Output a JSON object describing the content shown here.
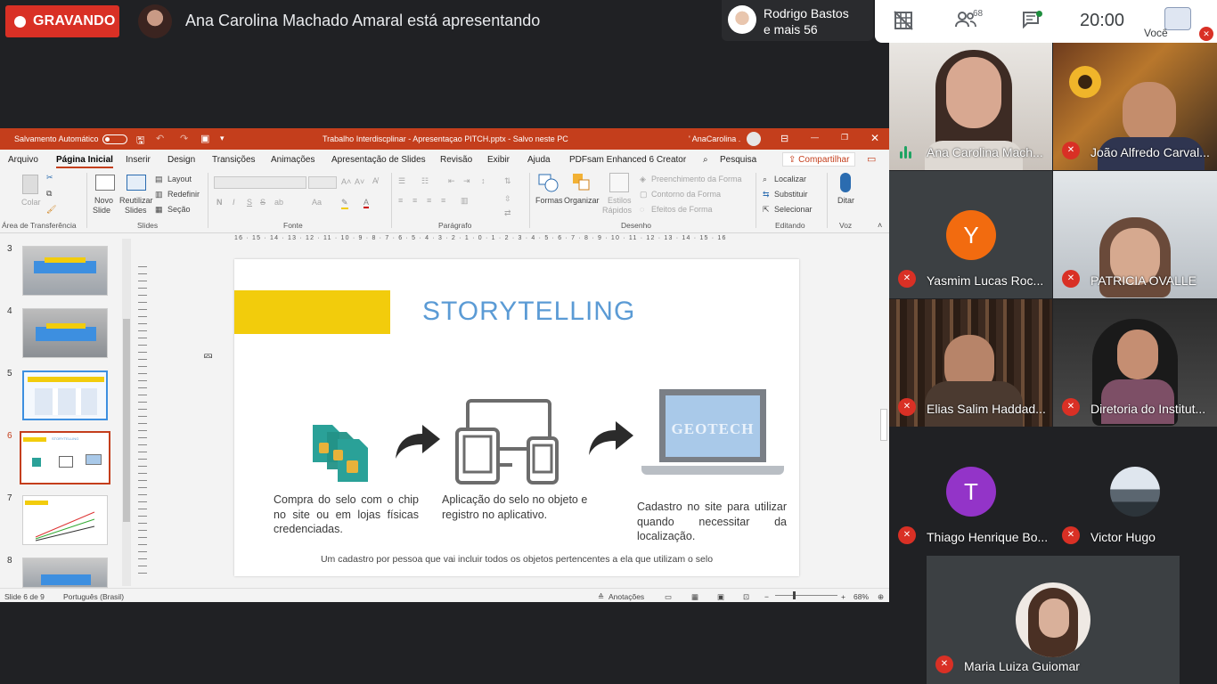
{
  "meet": {
    "recording_label": "GRAVANDO",
    "presenter_text": "Ana Carolina Machado Amaral está apresentando",
    "others_name": "Rodrigo Bastos",
    "others_more": "e mais 56",
    "participants_count": "68",
    "clock": "20:00",
    "you_label": "Você",
    "icons": [
      "grid-off-icon",
      "people-icon",
      "chat-icon",
      "mic-off-icon"
    ],
    "accent_red": "#d93025"
  },
  "ppt": {
    "autosave_label": "Salvamento Automático",
    "window_title": "Trabalho Interdiscplinar - Apresentaçao PITCH.pptx  -  Salvo neste PC",
    "user_name": "' AnaCarolina .",
    "menu": [
      "Arquivo",
      "Página Inicial",
      "Inserir",
      "Design",
      "Transições",
      "Animações",
      "Apresentação de Slides",
      "Revisão",
      "Exibir",
      "Ajuda",
      "PDFsam Enhanced 6 Creator",
      "Pesquisa"
    ],
    "share_label": "Compartilhar",
    "ribbon": {
      "paste": "Colar",
      "clipboard_group": "Área de Transferência",
      "new_slide": "Novo",
      "new_slide_2": "Slide",
      "reuse": "Reutilizar",
      "reuse_2": "Slides",
      "layout": "Layout",
      "reset": "Redefinir",
      "section": "Seção",
      "slides_group": "Slides",
      "font_group": "Fonte",
      "paragraph_group": "Parágrafo",
      "shapes": "Formas",
      "arrange": "Organizar",
      "quick_styles": "Estilos",
      "quick_styles_2": "Rápidos",
      "shape_fill": "Preenchimento da Forma",
      "shape_outline": "Contorno da Forma",
      "shape_effects": "Efeitos de Forma",
      "drawing_group": "Desenho",
      "find": "Localizar",
      "replace": "Substituir",
      "select": "Selecionar",
      "editing_group": "Editando",
      "dictate": "Ditar",
      "voice_group": "Voz"
    },
    "thumbnails": [
      {
        "num": "3"
      },
      {
        "num": "4"
      },
      {
        "num": "5"
      },
      {
        "num": "6"
      },
      {
        "num": "7"
      },
      {
        "num": "8"
      }
    ],
    "ruler_top": "16 · 15 · 14 · 13 · 12 · 11 · 10 · 9 · 8 · 7 · 6 · 5 · 4 · 3 · 2 · 1 · 0 · 1 · 2 · 3 · 4 · 5 · 6 · 7 · 8 · 9 · 10 · 11 · 12 · 13 · 14 · 15 · 16",
    "slide": {
      "title": "STORYTELLING",
      "monitor_text": "GEOTECH",
      "step1": "Compra do selo com o chip no site ou em lojas físicas credenciadas.",
      "step2": "Aplicação do selo no objeto e registro no aplicativo.",
      "step3": "Cadastro no site para utilizar quando necessitar da localização.",
      "footer": "Um cadastro por pessoa que vai incluir todos os objetos pertencentes a ela que utilizam o selo",
      "accent_yellow": "#f2cc0c",
      "title_color": "#5b9bd5",
      "icon_green": "#2aa198"
    },
    "status": {
      "slide_pos": "Slide 6 de 9",
      "language": "Português (Brasil)",
      "notes": "Anotações",
      "zoom": "68%"
    },
    "title_bar_color": "#c43e1c"
  },
  "participants": [
    {
      "name": "Ana Carolina Mach...",
      "speaking": true
    },
    {
      "name": "João Alfredo Carval..."
    },
    {
      "name": "Yasmim Lucas Roc...",
      "initial": "Y",
      "color": "#f26b0f"
    },
    {
      "name": "PATRICIA OVALLE"
    },
    {
      "name": "Elias Salim Haddad..."
    },
    {
      "name": "Diretoria do Institut..."
    },
    {
      "name": "Thiago Henrique Bo...",
      "initial": "T",
      "color": "#9334c8"
    },
    {
      "name": "Victor Hugo"
    },
    {
      "name": "Maria Luiza Guiomar"
    }
  ]
}
